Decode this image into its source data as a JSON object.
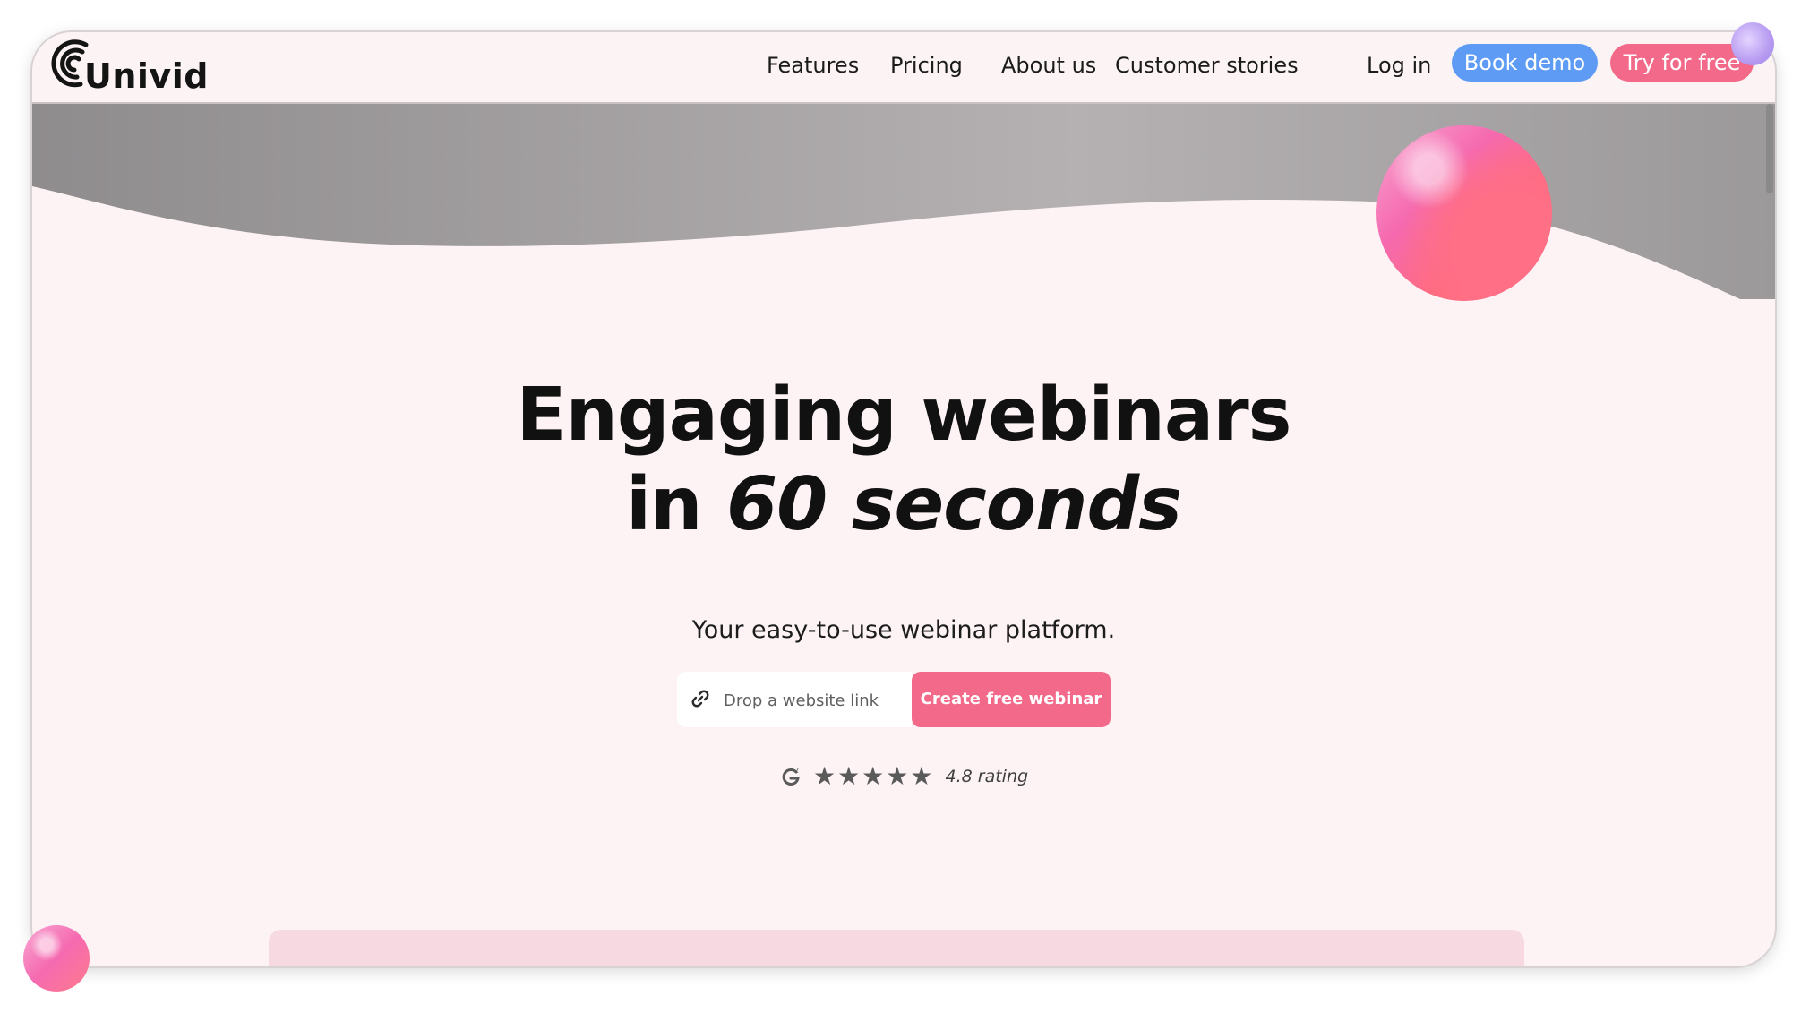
{
  "brand": {
    "name": "Univid"
  },
  "nav": {
    "items": [
      {
        "label": "Features"
      },
      {
        "label": "Pricing"
      },
      {
        "label": "About us"
      },
      {
        "label": "Customer stories"
      }
    ],
    "login_label": "Log in",
    "book_demo_label": "Book demo",
    "try_free_label": "Try for free"
  },
  "hero": {
    "title_line1": "Engaging webinars",
    "title_line2_prefix": "in ",
    "title_line2_emphasis": "60 seconds",
    "subtitle": "Your easy-to-use webinar platform.",
    "link_input_placeholder": "Drop a website link",
    "link_input_value": "",
    "cta_label": "Create free webinar"
  },
  "rating": {
    "stars": 5,
    "text": "4.8 rating"
  },
  "colors": {
    "page_background": "#fdf3f5",
    "accent_pink": "#f26989",
    "accent_blue": "#5d9bf4",
    "wave_gray": "#9a9697"
  },
  "icons": {
    "logo_mark": "univid-logo-icon",
    "link": "link-icon",
    "g2": "g2-icon",
    "star": "star-icon"
  }
}
